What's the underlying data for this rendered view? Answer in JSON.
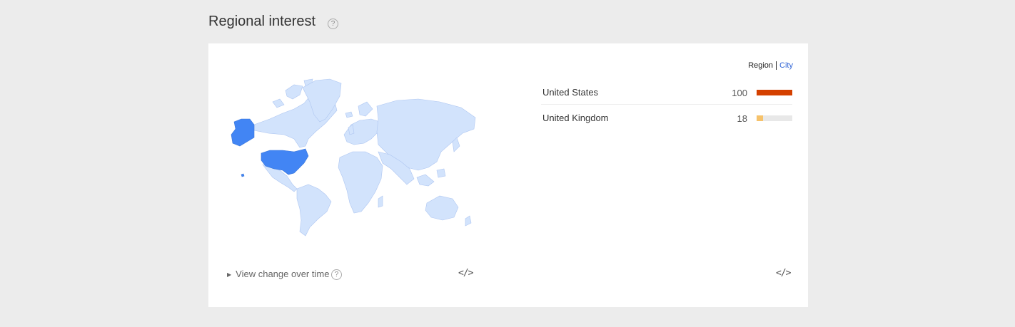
{
  "section": {
    "title": "Regional interest",
    "help_glyph": "?"
  },
  "resolution_toggle": {
    "region_label": "Region",
    "city_label": "City",
    "selected": "Region"
  },
  "rankings": [
    {
      "name": "United States",
      "value": "100",
      "fraction": 1.0,
      "color": "#d44000"
    },
    {
      "name": "United Kingdom",
      "value": "18",
      "fraction": 0.18,
      "color": "#f6c26b"
    }
  ],
  "footer": {
    "view_change_label": "View change over time",
    "embed_glyph": "</>"
  },
  "map": {
    "highlight_color": "#4285f4",
    "base_color": "#d2e3fc",
    "border_color": "#aec6f1"
  }
}
